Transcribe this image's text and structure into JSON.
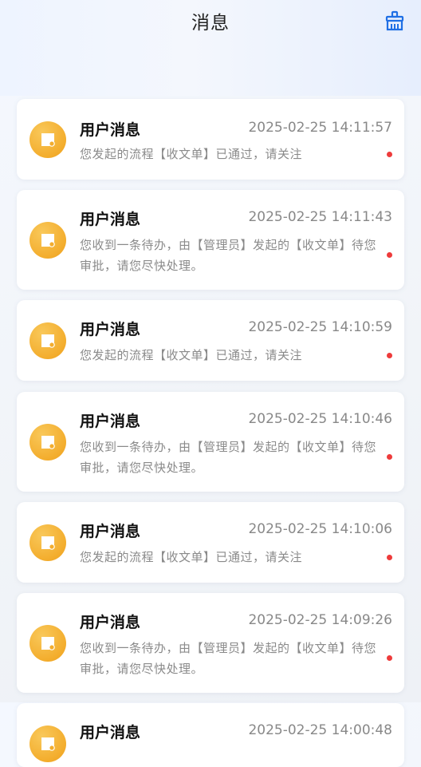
{
  "header": {
    "title": "消息",
    "clear_icon": "broom-icon"
  },
  "colors": {
    "avatar": "#f3ad2d",
    "unread_dot": "#ee3b3b"
  },
  "messages": [
    {
      "title": "用户消息",
      "time": "2025-02-25 14:11:57",
      "content": "您发起的流程【收文单】已通过，请关注",
      "unread": true
    },
    {
      "title": "用户消息",
      "time": "2025-02-25 14:11:43",
      "content": "您收到一条待办，由【管理员】发起的【收文单】待您审批，请您尽快处理。",
      "unread": true
    },
    {
      "title": "用户消息",
      "time": "2025-02-25 14:10:59",
      "content": "您发起的流程【收文单】已通过，请关注",
      "unread": true
    },
    {
      "title": "用户消息",
      "time": "2025-02-25 14:10:46",
      "content": "您收到一条待办，由【管理员】发起的【收文单】待您审批，请您尽快处理。",
      "unread": true
    },
    {
      "title": "用户消息",
      "time": "2025-02-25 14:10:06",
      "content": "您发起的流程【收文单】已通过，请关注",
      "unread": true
    },
    {
      "title": "用户消息",
      "time": "2025-02-25 14:09:26",
      "content": "您收到一条待办，由【管理员】发起的【收文单】待您审批，请您尽快处理。",
      "unread": true
    },
    {
      "title": "用户消息",
      "time": "2025-02-25 14:00:48",
      "content": "",
      "unread": false
    }
  ]
}
